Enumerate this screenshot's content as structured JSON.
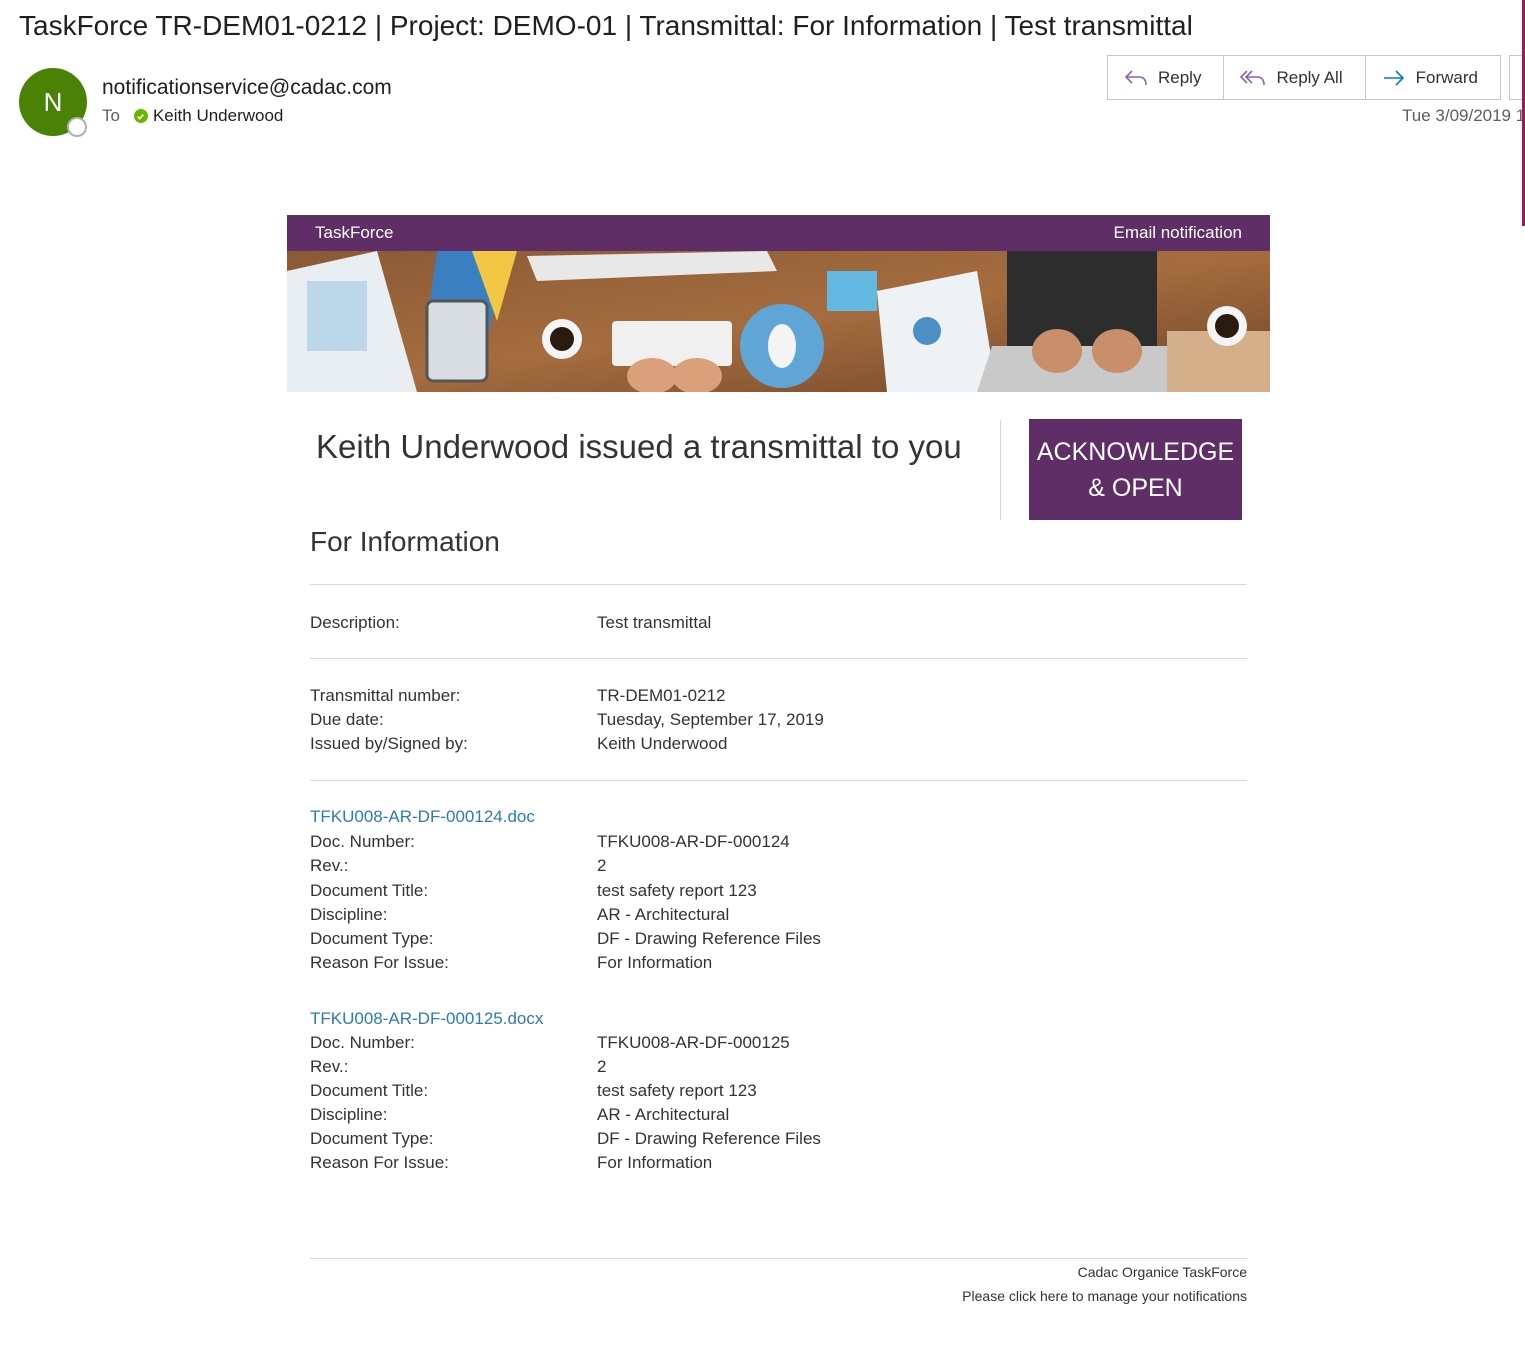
{
  "email": {
    "subject": "TaskForce TR-DEM01-0212 | Project: DEMO-01 | Transmittal: For Information | Test transmittal",
    "avatar_initial": "N",
    "sender": "notificationservice@cadac.com",
    "to_label": "To",
    "recipient": "Keith Underwood",
    "date": "Tue 3/09/2019 1",
    "actions": {
      "reply": "Reply",
      "reply_all": "Reply All",
      "forward": "Forward"
    }
  },
  "card": {
    "brand": "TaskForce",
    "notice": "Email notification",
    "headline": "Keith Underwood issued a transmittal to you",
    "purpose": "For Information",
    "ack_line1": "ACKNOWLEDGE",
    "ack_line2": "& OPEN",
    "colors": {
      "accent": "#5f2e66",
      "link": "#2b7bb9",
      "avatar": "#498205"
    }
  },
  "details": {
    "description_label": "Description:",
    "description": "Test transmittal",
    "rows": [
      {
        "label": "Transmittal number:",
        "value": "TR-DEM01-0212"
      },
      {
        "label": "Due date:",
        "value": "Tuesday, September 17, 2019"
      },
      {
        "label": "Issued by/Signed by:",
        "value": "Keith Underwood"
      }
    ]
  },
  "documents": [
    {
      "file": "TFKU008-AR-DF-000124.doc",
      "fields": [
        {
          "label": "Doc. Number:",
          "value": "TFKU008-AR-DF-000124"
        },
        {
          "label": "Rev.:",
          "value": "2"
        },
        {
          "label": "Document Title:",
          "value": "test safety report 123"
        },
        {
          "label": "Discipline:",
          "value": "AR - Architectural"
        },
        {
          "label": "Document Type:",
          "value": "DF - Drawing Reference Files"
        },
        {
          "label": "Reason For Issue:",
          "value": "For Information"
        }
      ]
    },
    {
      "file": "TFKU008-AR-DF-000125.docx",
      "fields": [
        {
          "label": "Doc. Number:",
          "value": "TFKU008-AR-DF-000125"
        },
        {
          "label": "Rev.:",
          "value": "2"
        },
        {
          "label": "Document Title:",
          "value": "test safety report 123"
        },
        {
          "label": "Discipline:",
          "value": "AR - Architectural"
        },
        {
          "label": "Document Type:",
          "value": "DF - Drawing Reference Files"
        },
        {
          "label": "Reason For Issue:",
          "value": "For Information"
        }
      ]
    }
  ],
  "footer": {
    "line1": "Cadac Organice TaskForce",
    "line2": "Please click here to manage your notifications"
  }
}
